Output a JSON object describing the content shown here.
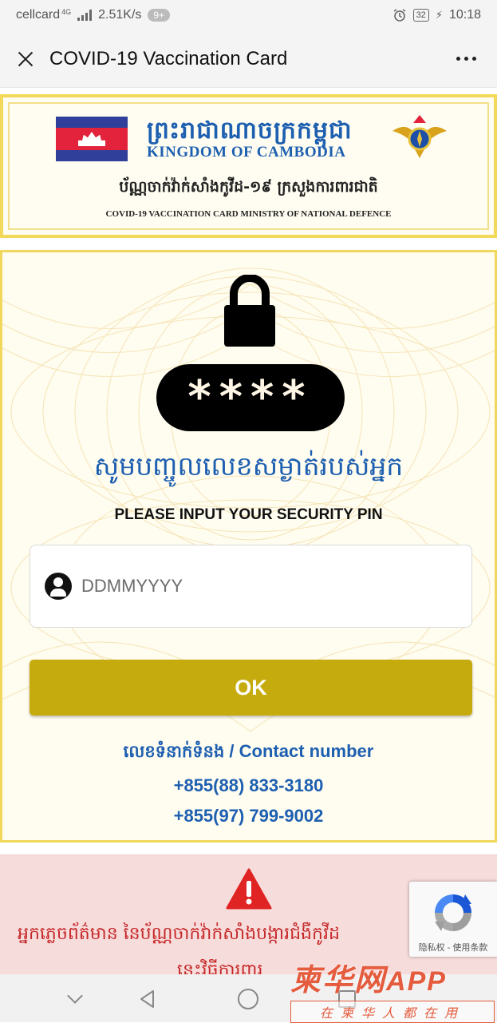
{
  "status_bar": {
    "carrier": "cellcard",
    "network": "4G",
    "speed": "2.51K/s",
    "notifications": "9+",
    "battery": "32",
    "time": "10:18"
  },
  "title_bar": {
    "title": "COVID-19 Vaccination Card"
  },
  "banner": {
    "khmer_title": "ព្រះរាជាណាចក្រកម្ពុជា",
    "kingdom": "KINGDOM OF CAMBODIA",
    "khmer_subtitle": "ប័ណ្ណចាក់វ៉ាក់សាំងកូវីដ-១៩ ក្រសួងការពារជាតិ",
    "card_subtitle": "COVID-19 VACCINATION CARD  MINISTRY OF NATIONAL DEFENCE"
  },
  "pin_panel": {
    "pin_mask": "****",
    "prompt_khmer": "សូមបញ្ចូលលេខសម្ងាត់របស់អ្នក",
    "prompt_english": "PLEASE INPUT YOUR SECURITY PIN",
    "input_placeholder": "DDMMYYYY",
    "input_value": "",
    "ok_label": "OK"
  },
  "contact": {
    "label_khmer": "លេខទំនាក់ទំនង",
    "label_english": "/ Contact number",
    "phones": [
      "+855(88) 833-3180",
      "+855(97) 799-9002"
    ]
  },
  "warning": {
    "text_line1": "អ្នកភ្លេចព័ត៌មាន នៃប័ណ្ណចាក់វ៉ាក់សាំងបង្ការជំងឺកូវីដ",
    "text_line2": "នេះវិធីការពារ"
  },
  "recaptcha": {
    "links": "隐私权 - 使用条款"
  },
  "watermark": {
    "brand": "柬华网",
    "app": "APP",
    "slogan": "在柬华人都在用"
  },
  "colors": {
    "accent_blue": "#1d5fb0",
    "ok_button": "#c6ab0e",
    "gold_border": "#f1d75b",
    "warning_red": "#c62828"
  }
}
